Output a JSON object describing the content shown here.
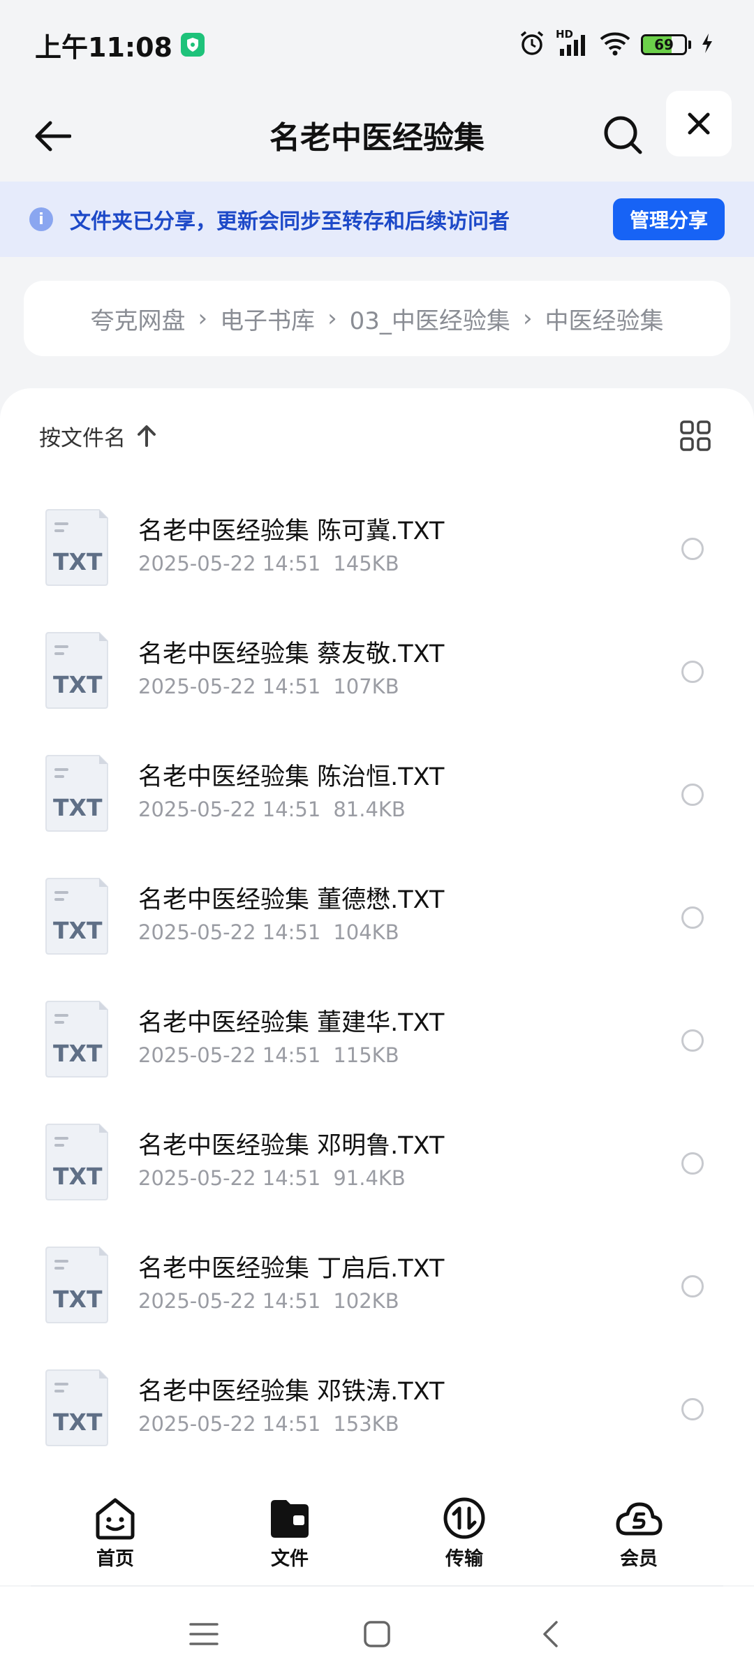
{
  "status_bar": {
    "time": "上午11:08",
    "battery_level": "69",
    "battery_fraction": 0.69,
    "icons": [
      "shield-icon",
      "alarm-icon",
      "signal-icon",
      "wifi-icon",
      "battery-icon",
      "charging-icon"
    ],
    "network_label": "HD"
  },
  "header": {
    "title": "名老中医经验集",
    "icons": [
      "back-arrow-icon",
      "search-icon",
      "close-icon"
    ]
  },
  "share_banner": {
    "message": "文件夹已分享，更新会同步至转存和后续访问者",
    "button_label": "管理分享",
    "icon": "info-icon",
    "info_glyph": "i"
  },
  "breadcrumb": [
    "夸克网盘",
    "电子书库",
    "03_中医经验集",
    "中医经验集"
  ],
  "sort": {
    "label": "按文件名",
    "icons": [
      "sort-ascending-icon",
      "grid-view-icon"
    ]
  },
  "file_type_label": "TXT",
  "files": [
    {
      "name": "名老中医经验集 陈可冀.TXT",
      "date": "2025-05-22 14:51",
      "size": "145KB"
    },
    {
      "name": "名老中医经验集 蔡友敬.TXT",
      "date": "2025-05-22 14:51",
      "size": "107KB"
    },
    {
      "name": "名老中医经验集 陈治恒.TXT",
      "date": "2025-05-22 14:51",
      "size": "81.4KB"
    },
    {
      "name": "名老中医经验集 董德懋.TXT",
      "date": "2025-05-22 14:51",
      "size": "104KB"
    },
    {
      "name": "名老中医经验集 董建华.TXT",
      "date": "2025-05-22 14:51",
      "size": "115KB"
    },
    {
      "name": "名老中医经验集 邓明鲁.TXT",
      "date": "2025-05-22 14:51",
      "size": "91.4KB"
    },
    {
      "name": "名老中医经验集 丁启后.TXT",
      "date": "2025-05-22 14:51",
      "size": "102KB"
    },
    {
      "name": "名老中医经验集 邓铁涛.TXT",
      "date": "2025-05-22 14:51",
      "size": "153KB"
    }
  ],
  "bottom_nav": [
    {
      "label": "首页",
      "icon": "home-face-icon"
    },
    {
      "label": "文件",
      "icon": "folder-icon",
      "active": true
    },
    {
      "label": "传输",
      "icon": "transfer-icon"
    },
    {
      "label": "会员",
      "icon": "member-cloud-icon"
    }
  ],
  "system_nav": [
    "menu-icon",
    "home-square-icon",
    "back-chevron-icon"
  ],
  "colors": {
    "accent": "#1763f5",
    "banner_bg": "#e6ebfb",
    "banner_text": "#1d49c8",
    "page_bg": "#f3f4f6",
    "battery_fill": "#6cd04a",
    "shield": "#1ec27a"
  }
}
